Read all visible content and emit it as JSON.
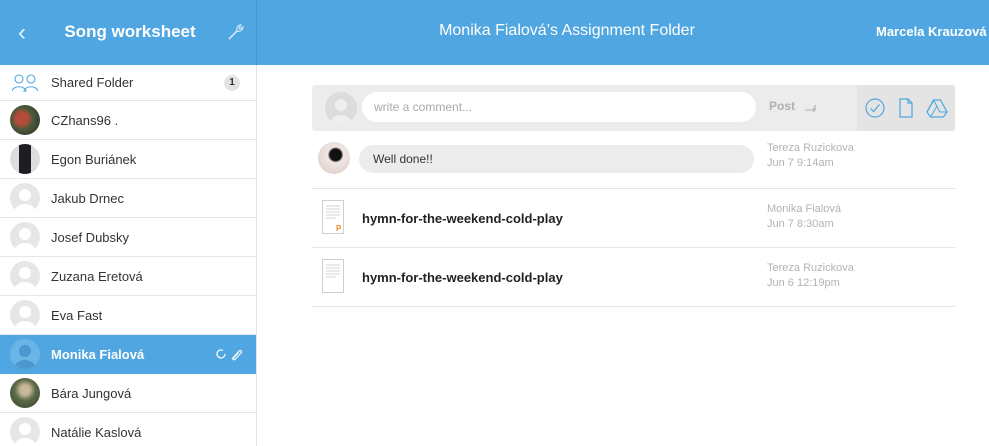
{
  "header": {
    "back_icon": "chevron-left-icon",
    "sidebar_title": "Song worksheet",
    "settings_icon": "wrench-icon",
    "main_title": "Monika Fialová’s Assignment Folder",
    "user_name": "Marcela Krauzová",
    "accent_color": "#4fa6e0"
  },
  "sidebar": {
    "items": [
      {
        "label": "Shared Folder",
        "badge": "1",
        "icon": "group-icon"
      },
      {
        "label": "CZhans96 ."
      },
      {
        "label": "Egon Buriánek"
      },
      {
        "label": "Jakub Drnec"
      },
      {
        "label": "Josef Dubsky"
      },
      {
        "label": "Zuzana Eretová"
      },
      {
        "label": "Eva Fast"
      },
      {
        "label": "Monika Fialová",
        "active": true
      },
      {
        "label": "Bára Jungová"
      },
      {
        "label": "Natálie Kaslová"
      }
    ]
  },
  "comment_bar": {
    "placeholder": "write a comment...",
    "post_label": "Post",
    "icons": [
      "check-circle-icon",
      "document-icon",
      "google-drive-icon"
    ]
  },
  "feed": {
    "comment": {
      "text": "Well done!!",
      "author": "Tereza Ruzickova",
      "date": "Jun 7 9:14am"
    },
    "files": [
      {
        "name": "hymn-for-the-weekend-cold-play",
        "author": "Monika Fialová",
        "date": "Jun 7 8:30am",
        "icon": "pages-document-icon"
      },
      {
        "name": "hymn-for-the-weekend-cold-play",
        "author": "Tereza Ruzickova",
        "date": "Jun 6 12:19pm",
        "icon": "document-icon"
      }
    ]
  }
}
